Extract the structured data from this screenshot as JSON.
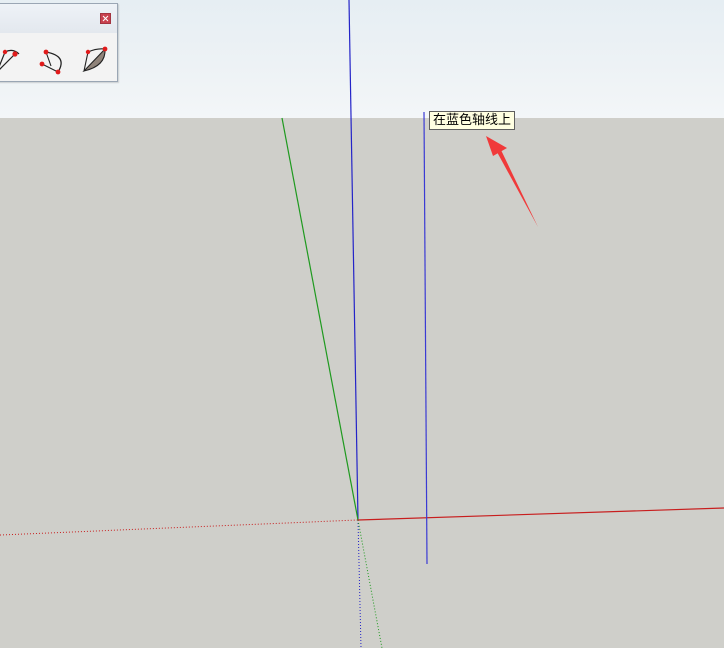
{
  "viewport": {
    "sky_color": "#edf2f5",
    "ground_color": "#cfcfca"
  },
  "axes": {
    "red_axis_color": "#c81e1e",
    "green_axis_color": "#1f9a1f",
    "blue_axis_color": "#2424c8"
  },
  "toolbar": {
    "close_label": "x",
    "tools": [
      {
        "icon": "arc-tool-icon"
      },
      {
        "icon": "two-point-arc-icon"
      },
      {
        "icon": "pie-tool-icon"
      }
    ]
  },
  "inference_tooltip": {
    "text": "在蓝色轴线上"
  },
  "annotation_arrow": {
    "color": "#f03a3a"
  }
}
